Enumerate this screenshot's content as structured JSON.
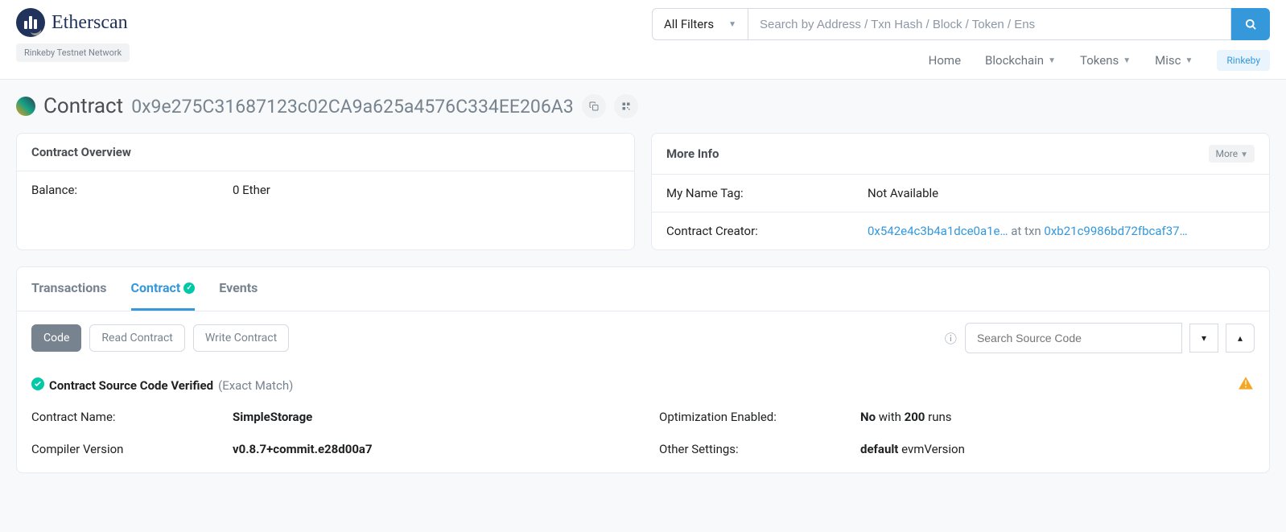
{
  "header": {
    "logo_text": "Etherscan",
    "network_badge": "Rinkeby Testnet Network",
    "filter_label": "All Filters",
    "search_placeholder": "Search by Address / Txn Hash / Block / Token / Ens",
    "nav": {
      "home": "Home",
      "blockchain": "Blockchain",
      "tokens": "Tokens",
      "misc": "Misc",
      "rinkeby": "Rinkeby"
    }
  },
  "page": {
    "title_label": "Contract",
    "address": "0x9e275C31687123c02CA9a625a4576C334EE206A3"
  },
  "overview": {
    "title": "Contract Overview",
    "balance_label": "Balance:",
    "balance_value": "0 Ether"
  },
  "moreinfo": {
    "title": "More Info",
    "more_btn": "More",
    "nametag_label": "My Name Tag:",
    "nametag_value": "Not Available",
    "creator_label": "Contract Creator:",
    "creator_addr": "0x542e4c3b4a1dce0a1e…",
    "at_txn": " at txn ",
    "creator_txn": "0xb21c9986bd72fbcaf37…"
  },
  "tabs": {
    "transactions": "Transactions",
    "contract": "Contract",
    "events": "Events"
  },
  "subtabs": {
    "code": "Code",
    "read": "Read Contract",
    "write": "Write Contract",
    "search_placeholder": "Search Source Code"
  },
  "verified": {
    "text": "Contract Source Code Verified",
    "match": "(Exact Match)"
  },
  "details": {
    "name_label": "Contract Name:",
    "name_value": "SimpleStorage",
    "compiler_label": "Compiler Version",
    "compiler_value": "v0.8.7+commit.e28d00a7",
    "opt_label": "Optimization Enabled:",
    "opt_no": "No",
    "opt_with": " with ",
    "opt_runs": "200",
    "opt_runs_suffix": " runs",
    "settings_label": "Other Settings:",
    "settings_default": "default",
    "settings_evm": " evmVersion"
  }
}
